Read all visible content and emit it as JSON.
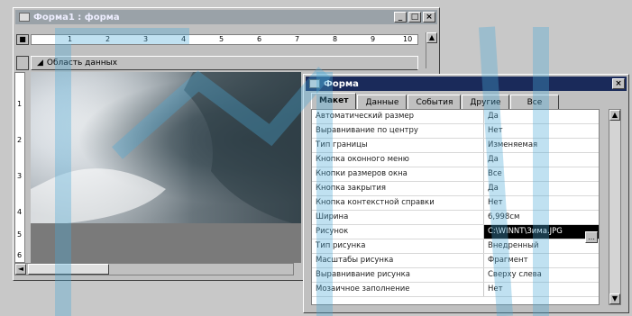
{
  "form_window": {
    "title": "Форма1 : форма",
    "buttons": {
      "minimize": "_",
      "maximize": "□",
      "close": "×"
    },
    "section_label": "Область данных",
    "ruler_top": [
      "1",
      "2",
      "3",
      "4",
      "5",
      "6",
      "7",
      "8",
      "9",
      "10"
    ],
    "ruler_left": [
      "1",
      "2",
      "3",
      "4",
      "5",
      "6"
    ]
  },
  "properties_window": {
    "title": "Форма",
    "close": "×",
    "tabs": [
      {
        "label": "Макет",
        "active": true
      },
      {
        "label": "Данные",
        "active": false
      },
      {
        "label": "События",
        "active": false
      },
      {
        "label": "Другие",
        "active": false
      },
      {
        "label": "Все",
        "active": false
      }
    ],
    "properties": [
      {
        "name": "Автоматический размер",
        "value": "Да"
      },
      {
        "name": "Выравнивание по центру",
        "value": "Нет"
      },
      {
        "name": "Тип границы",
        "value": "Изменяемая"
      },
      {
        "name": "Кнопка оконного меню",
        "value": "Да"
      },
      {
        "name": "Кнопки размеров окна",
        "value": "Все"
      },
      {
        "name": "Кнопка закрытия",
        "value": "Да"
      },
      {
        "name": "Кнопка контекстной справки",
        "value": "Нет"
      },
      {
        "name": "Ширина",
        "value": "6,998см"
      },
      {
        "name": "Рисунок",
        "value": "C:\\WINNT\\Зима.JPG",
        "selected": true
      },
      {
        "name": "Тип рисунка",
        "value": "Внедренный"
      },
      {
        "name": "Масштабы рисунка",
        "value": "Фрагмент"
      },
      {
        "name": "Выравнивание рисунка",
        "value": "Сверху слева"
      },
      {
        "name": "Мозаичное заполнение",
        "value": "Нет"
      }
    ]
  },
  "icons": {
    "form_icon": "form-icon",
    "section_icon": "section-marker-icon",
    "properties_icon": "properties-icon",
    "scroll_up": "▲",
    "scroll_down": "▼",
    "scroll_left": "◄",
    "dropdown": "▼",
    "builder": "…"
  },
  "colors": {
    "properties_titlebar": "#1a2a5a",
    "form_titlebar": "#9aa2a8",
    "watermark": "#4aa8d8"
  }
}
